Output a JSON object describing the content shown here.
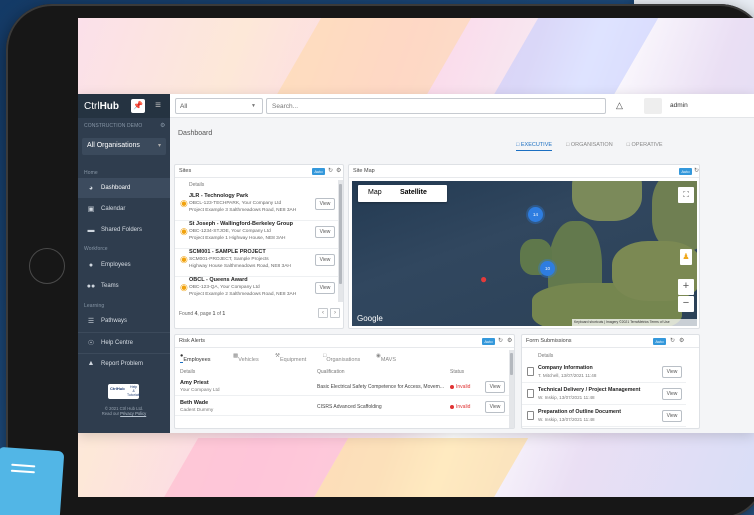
{
  "app": {
    "brand_light": "Ctrl",
    "brand_bold": "Hub",
    "company_label": "CONSTRUCTION DEMO",
    "org_select": "All Organisations"
  },
  "sidebar": {
    "section_home": "Home",
    "section_workforce": "Workforce",
    "section_learning": "Learning",
    "items": [
      {
        "label": "Dashboard",
        "icon": "speedometer-icon"
      },
      {
        "label": "Calendar",
        "icon": "calendar-icon"
      },
      {
        "label": "Shared Folders",
        "icon": "folder-icon"
      },
      {
        "label": "Employees",
        "icon": "person-icon"
      },
      {
        "label": "Teams",
        "icon": "group-icon"
      },
      {
        "label": "Pathways",
        "icon": "list-icon"
      },
      {
        "label": "Help Centre",
        "icon": "lifebuoy-icon"
      },
      {
        "label": "Report Problem",
        "icon": "bug-icon"
      }
    ],
    "logo_text": "CtrlHub",
    "logo_help": "Help",
    "logo_amp": "&",
    "logo_tutorials": "Tutorials",
    "footer_copy": "© 2021 Ctrl Hub Ltd.",
    "footer_read": "Read our",
    "footer_link": "Privacy Policy"
  },
  "topbar": {
    "filter_value": "All",
    "search_placeholder": "Search...",
    "user_name": "admin"
  },
  "page": {
    "title": "Dashboard"
  },
  "tabs": [
    "EXECUTIVE",
    "ORGANISATION",
    "OPERATIVE"
  ],
  "sites": {
    "title": "Sites",
    "auto": "Auto",
    "col": "Details",
    "rows": [
      {
        "name": "JLR - Technology Park",
        "code": "OBCL-123-TECHPARK, Your Company Ltd",
        "addr": "Project Example 3 Salthmeadows Road, NE8 3AH",
        "btn": "View"
      },
      {
        "name": "St Joseph - Wallingford-Berkeley Group",
        "code": "OBC-1234-STJOE, Your Company Ltd",
        "addr": "Project Example 1 Highway House, NE8 3AH",
        "btn": "View"
      },
      {
        "name": "SCM001 - SAMPLE PROJECT",
        "code": "SCM001-PROJECT, Sample Projects",
        "addr": "Highway House Salthmeadows Road, NE8 3AH",
        "btn": "View"
      },
      {
        "name": "OBCL - Queens Award",
        "code": "OBC-123-QA, Your Company Ltd",
        "addr": "Project Example 2 Salthmeadows Road, NE8 3AH",
        "btn": "View"
      }
    ],
    "footer_a": "Found ",
    "footer_b": "4",
    "footer_c": ", page ",
    "footer_d": "1",
    "footer_e": " of ",
    "footer_f": "1"
  },
  "sitemap": {
    "title": "Site Map",
    "auto": "Auto",
    "btn_map": "Map",
    "btn_sat": "Satellite",
    "cluster_a": "14",
    "cluster_b": "10",
    "google": "Google",
    "attrib": "Keyboard shortcuts | Imagery ©2021 TerraMetrics Terms of Use"
  },
  "risk": {
    "title": "Risk Alerts",
    "auto": "Auto",
    "tabs": [
      "Employees",
      "Vehicles",
      "Equipment",
      "Organisations",
      "MAVS"
    ],
    "cols": [
      "Details",
      "Qualification",
      "Status"
    ],
    "rows": [
      {
        "name": "Amy Priest",
        "company": "Your Company Ltd",
        "qual": "Basic Electrical Safety Competence for Access, Movem...",
        "status": "Invalid",
        "btn": "View"
      },
      {
        "name": "Beth Wade",
        "company": "Cadent Dummy",
        "qual": "CISRS Advanced Scaffolding",
        "status": "Invalid",
        "btn": "View"
      }
    ]
  },
  "forms": {
    "title": "Form Submissions",
    "auto": "Auto",
    "col": "Details",
    "rows": [
      {
        "title": "Company Information",
        "sub": "T. Mitchell, 13/07/2021 11:48",
        "btn": "View"
      },
      {
        "title": "Technical Delivery / Project Management",
        "sub": "W. Inskip, 13/07/2021 11:48",
        "btn": "View"
      },
      {
        "title": "Preparation of Outline Document",
        "sub": "W. Inskip, 13/07/2021 11:48",
        "btn": "View"
      }
    ]
  },
  "colors": {
    "sidebar": "#2f3d4e",
    "accent": "#1b6fc2",
    "invalid": "#e03434",
    "pin": "#f1a20c"
  }
}
